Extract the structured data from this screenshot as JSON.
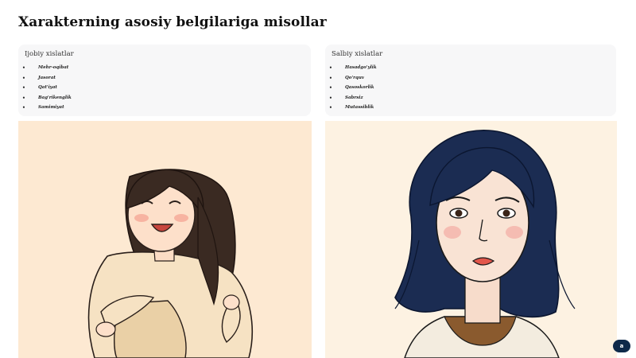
{
  "slide": {
    "title": "Xarakterning asosiy belgilariga misollar"
  },
  "positive": {
    "heading": "Ijobiy xislatlar",
    "items": [
      "Mehr-oqibat",
      "Jasorat",
      "Qat'iyat",
      "Bag'rikenglik",
      "Samimiyat"
    ]
  },
  "negative": {
    "heading": "Salbiy xislatlar",
    "items": [
      "Hasadgo'ylik",
      "Qo'rquv",
      "Qasoskorlik",
      "Sabrsiz",
      "Mutassiblik"
    ]
  },
  "illustrations": {
    "left": "hugging-girl-illustration",
    "right": "sad-woman-illustration"
  },
  "colors": {
    "card_bg": "#f7f7f8",
    "left_panel_bg": "#fde9d2",
    "right_panel_bg": "#fdf2e2",
    "badge_bg": "#0f2a4a"
  },
  "badge": {
    "label": "a"
  }
}
